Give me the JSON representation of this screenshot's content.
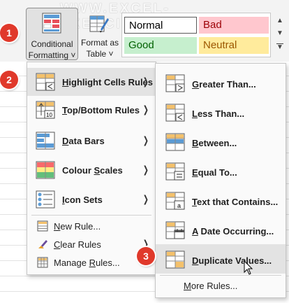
{
  "watermark": "WWW.EXCEL-EXERCISE.COM",
  "ribbon": {
    "conditional_formatting_line1": "Conditional",
    "conditional_formatting_line2": "Formatting ˅",
    "format_as_table_line1": "Format as",
    "format_as_table_line2": "Table ˅",
    "styles": {
      "normal": "Normal",
      "bad": "Bad",
      "good": "Good",
      "neutral": "Neutral"
    }
  },
  "colors": {
    "badge": "#e0392b",
    "bad_fill": "#ffc7ce",
    "good_fill": "#c6efce",
    "neutral_fill": "#ffeb9c"
  },
  "main_menu": {
    "items": [
      {
        "mnemonic": "H",
        "rest": "ighlight Cells Rules",
        "icon": "highlight-cells-icon",
        "submenu": true
      },
      {
        "mnemonic": "T",
        "rest": "op/Bottom Rules",
        "icon": "top-bottom-icon",
        "submenu": true
      },
      {
        "mnemonic": "D",
        "rest": "ata Bars",
        "icon": "data-bars-icon",
        "submenu": true
      },
      {
        "mnemonic": "S",
        "prefix": "Colour ",
        "rest": "cales",
        "icon": "colour-scales-icon",
        "submenu": true
      },
      {
        "mnemonic": "I",
        "rest": "con Sets",
        "icon": "icon-sets-icon",
        "submenu": true
      }
    ],
    "actions": [
      {
        "mnemonic": "N",
        "rest": "ew Rule...",
        "icon": "new-rule-icon"
      },
      {
        "mnemonic": "C",
        "rest": "lear Rules",
        "icon": "clear-rules-icon",
        "submenu": true
      },
      {
        "prefix": "Manage ",
        "mnemonic": "R",
        "rest": "ules...",
        "icon": "manage-rules-icon"
      }
    ]
  },
  "submenu": {
    "items": [
      {
        "mnemonic": "G",
        "rest": "reater Than...",
        "icon": "greater-than-icon"
      },
      {
        "mnemonic": "L",
        "rest": "ess Than...",
        "icon": "less-than-icon"
      },
      {
        "mnemonic": "B",
        "rest": "etween...",
        "icon": "between-icon"
      },
      {
        "mnemonic": "E",
        "rest": "qual To...",
        "icon": "equal-to-icon"
      },
      {
        "mnemonic": "T",
        "rest": "ext that Contains...",
        "icon": "text-contains-icon"
      },
      {
        "mnemonic": "A",
        "rest": " Date Occurring...",
        "icon": "date-occurring-icon"
      },
      {
        "mnemonic": "D",
        "rest": "uplicate Values...",
        "icon": "duplicate-values-icon"
      }
    ],
    "more_rules": {
      "prefix": "",
      "mnemonic": "M",
      "rest": "ore Rules..."
    }
  },
  "badges": [
    "1",
    "2",
    "3"
  ]
}
